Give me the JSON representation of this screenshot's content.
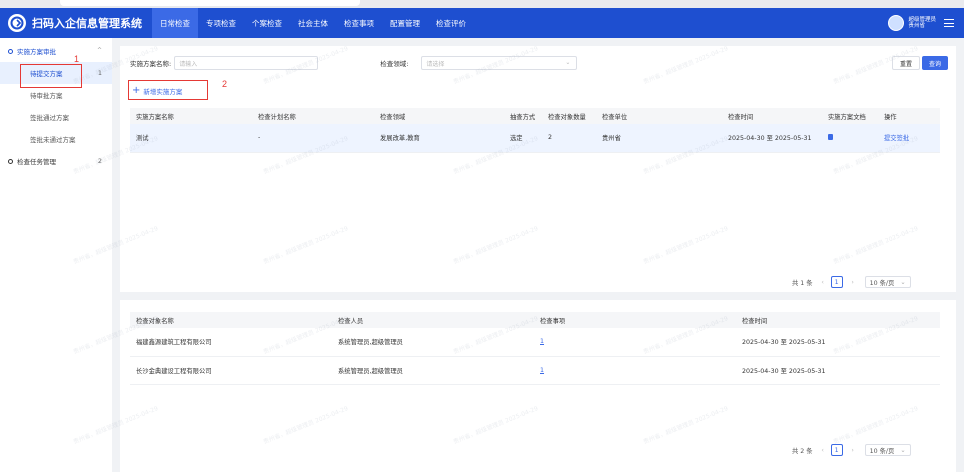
{
  "app": {
    "title": "扫码入企信息管理系统",
    "logo_icon": "qr-scan-logo-icon"
  },
  "nav": [
    {
      "label": "日常检查",
      "active": true
    },
    {
      "label": "专项检查",
      "active": false
    },
    {
      "label": "个案检查",
      "active": false
    },
    {
      "label": "社会主体",
      "active": false
    },
    {
      "label": "检查事项",
      "active": false
    },
    {
      "label": "配置管理",
      "active": false
    },
    {
      "label": "检查评价",
      "active": false
    }
  ],
  "user": {
    "name": "超级管理员",
    "org": "贵州省"
  },
  "sidebar": {
    "group1": {
      "label": "实施方案审批",
      "chevron": "^"
    },
    "items": [
      {
        "label": "待提交方案",
        "count": "1",
        "active": true
      },
      {
        "label": "待审批方案",
        "count": "",
        "active": false
      },
      {
        "label": "签批通过方案",
        "count": "",
        "active": false
      },
      {
        "label": "签批未通过方案",
        "count": "",
        "active": false
      }
    ],
    "group2": {
      "label": "检查任务管理",
      "count": "2"
    }
  },
  "annotations": {
    "one": "1",
    "two": "2"
  },
  "filters": {
    "name_label": "实施方案名称:",
    "name_placeholder": "请输入",
    "domain_label": "检查领域:",
    "domain_placeholder": "请选择",
    "reset": "重置",
    "query": "查询"
  },
  "add_button": "新增实施方案",
  "plan_table": {
    "headers": [
      "实施方案名称",
      "检查计划名称",
      "检查领域",
      "抽查方式",
      "检查对象数量",
      "检查单位",
      "检查时间",
      "实施方案文档",
      "操作"
    ],
    "rows": [
      {
        "name": "测试",
        "plan": "-",
        "domain": "发展改革,教育",
        "method": "选定",
        "count": "2",
        "unit": "贵州省",
        "time": "2025-04-30 至 2025-05-31",
        "op": "提交签批"
      }
    ]
  },
  "pager1": {
    "total": "共 1 条",
    "page": "1",
    "size": "10 条/页"
  },
  "target_table": {
    "headers": [
      "检查对象名称",
      "检查人员",
      "检查事项",
      "检查时间"
    ],
    "rows": [
      {
        "name": "福建鑫源建筑工程有限公司",
        "staff": "系统管理员,超级管理员",
        "item": "1",
        "time": "2025-04-30 至 2025-05-31"
      },
      {
        "name": "长沙金典建设工程有限公司",
        "staff": "系统管理员,超级管理员",
        "item": "1",
        "time": "2025-04-30 至 2025-05-31"
      }
    ]
  },
  "pager2": {
    "total": "共 2 条",
    "page": "1",
    "size": "10 条/页"
  },
  "watermark": "贵州省，超级管理员 2025-04-29",
  "colors": {
    "primary": "#1e4fd0",
    "accent": "#3b6ae6",
    "annotation": "#e53935"
  }
}
